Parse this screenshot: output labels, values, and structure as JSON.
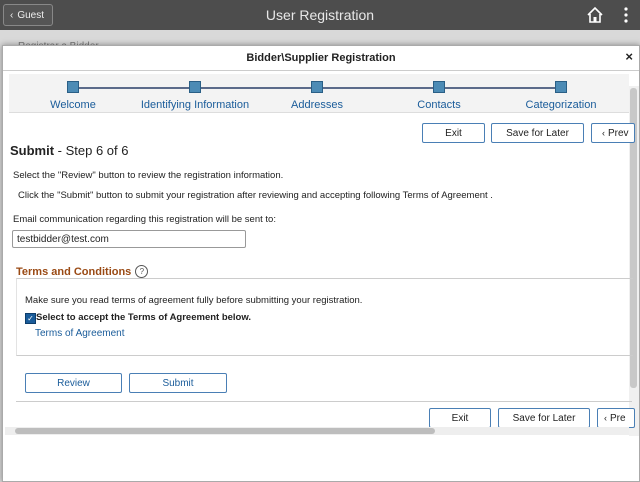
{
  "topbar": {
    "back_label": "Guest",
    "title": "User Registration",
    "home_icon": "home-icon",
    "menu_icon": "kebab-menu-icon"
  },
  "background": {
    "partial_text": "Registrar a Bidder"
  },
  "modal": {
    "title": "Bidder\\Supplier Registration",
    "close_glyph": "×"
  },
  "train": {
    "steps": [
      {
        "label": "Welcome"
      },
      {
        "label": "Identifying Information"
      },
      {
        "label": "Addresses"
      },
      {
        "label": "Contacts"
      },
      {
        "label": "Categorization"
      }
    ],
    "dot_color": "#4c8bb5"
  },
  "toolbar_top": {
    "exit": "Exit",
    "save_later": "Save for Later",
    "previous": "Prev"
  },
  "heading": {
    "bold": "Submit",
    "rest": " - Step 6 of 6"
  },
  "instructions": {
    "line1": "Select the \"Review\" button to review the registration information.",
    "line2": "Click the \"Submit\" button to submit your registration after reviewing and accepting following Terms of Agreement ."
  },
  "email": {
    "label": "Email communication regarding this registration will be sent to:",
    "value": "testbidder@test.com"
  },
  "terms": {
    "title": "Terms and Conditions",
    "help_glyph": "?",
    "note": "Make sure you read terms of agreement fully before submitting your registration.",
    "checkbox_label": "Select to accept the Terms of Agreement below.",
    "checked": true,
    "link": "Terms of Agreement"
  },
  "actions": {
    "review": "Review",
    "submit": "Submit"
  },
  "toolbar_bottom": {
    "exit": "Exit",
    "save_later": "Save for Later",
    "previous": "Pre"
  },
  "colors": {
    "accent": "#1a5c9a",
    "section_title": "#9a4a14",
    "topbar": "#4d4d4d"
  }
}
